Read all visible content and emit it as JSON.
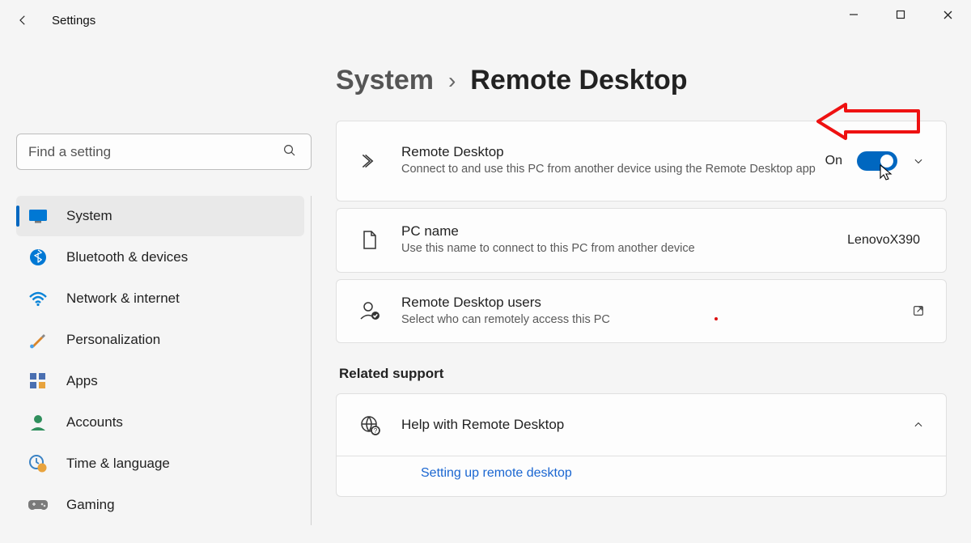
{
  "window": {
    "title": "Settings"
  },
  "search": {
    "placeholder": "Find a setting"
  },
  "sidebar": {
    "items": [
      {
        "label": "System"
      },
      {
        "label": "Bluetooth & devices"
      },
      {
        "label": "Network & internet"
      },
      {
        "label": "Personalization"
      },
      {
        "label": "Apps"
      },
      {
        "label": "Accounts"
      },
      {
        "label": "Time & language"
      },
      {
        "label": "Gaming"
      }
    ]
  },
  "breadcrumb": {
    "parent": "System",
    "current": "Remote Desktop"
  },
  "cards": {
    "remote": {
      "title": "Remote Desktop",
      "desc": "Connect to and use this PC from another device using the Remote Desktop app",
      "toggle_label": "On"
    },
    "pcname": {
      "title": "PC name",
      "desc": "Use this name to connect to this PC from another device",
      "value": "LenovoX390"
    },
    "users": {
      "title": "Remote Desktop users",
      "desc": "Select who can remotely access this PC"
    }
  },
  "related": {
    "heading": "Related support",
    "help_title": "Help with Remote Desktop",
    "link": "Setting up remote desktop"
  }
}
